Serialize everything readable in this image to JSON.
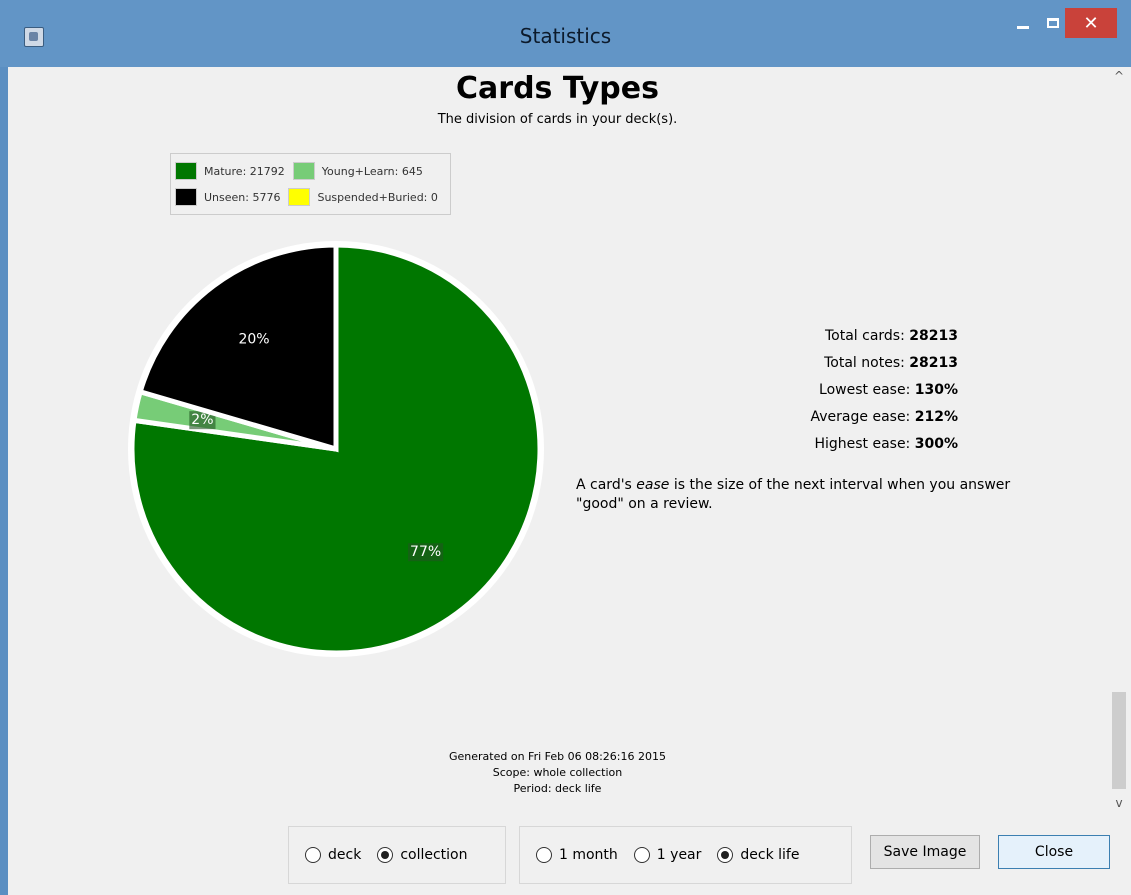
{
  "window": {
    "title": "Statistics",
    "minimize_icon": "minimize-icon",
    "maximize_icon": "maximize-icon",
    "close_icon": "close-icon",
    "close_glyph": "✕"
  },
  "page": {
    "heading": "Cards Types",
    "subtitle": "The division of cards in your deck(s)."
  },
  "chart_data": {
    "type": "pie",
    "title": "Cards Types",
    "subtitle": "The division of cards in your deck(s).",
    "series": [
      {
        "name": "Mature",
        "value": 21792,
        "percent_label": "77%",
        "color": "#007700"
      },
      {
        "name": "Young+Learn",
        "value": 645,
        "percent_label": "2%",
        "color": "#77cc77"
      },
      {
        "name": "Unseen",
        "value": 5776,
        "percent_label": "20%",
        "color": "#000000"
      },
      {
        "name": "Suspended+Buried",
        "value": 0,
        "percent_label": "",
        "color": "#ffff00"
      }
    ],
    "legend": [
      "Mature: 21792",
      "Young+Learn: 645",
      "Unseen: 5776",
      "Suspended+Buried: 0"
    ],
    "legend_placement": "top-left"
  },
  "stats": {
    "total_cards_label": "Total cards:",
    "total_cards_value": "28213",
    "total_notes_label": "Total notes:",
    "total_notes_value": "28213",
    "lowest_ease_label": "Lowest ease:",
    "lowest_ease_value": "130%",
    "average_ease_label": "Average ease:",
    "average_ease_value": "212%",
    "highest_ease_label": "Highest ease:",
    "highest_ease_value": "300%"
  },
  "ease_note": {
    "before": "A card's ",
    "emphasis": "ease",
    "after": " is the size of the next interval when you answer \"good\" on a review."
  },
  "footer": {
    "generated": "Generated on Fri Feb 06 08:26:16 2015",
    "scope": "Scope: whole collection",
    "period": "Period: deck life"
  },
  "controls": {
    "scope_options": [
      {
        "label": "deck",
        "selected": false
      },
      {
        "label": "collection",
        "selected": true
      }
    ],
    "period_options": [
      {
        "label": "1 month",
        "selected": false
      },
      {
        "label": "1 year",
        "selected": false
      },
      {
        "label": "deck life",
        "selected": true
      }
    ],
    "save_image_label": "Save Image",
    "close_label": "Close"
  },
  "scrollbar": {
    "up_glyph": "^",
    "down_glyph": "v"
  }
}
